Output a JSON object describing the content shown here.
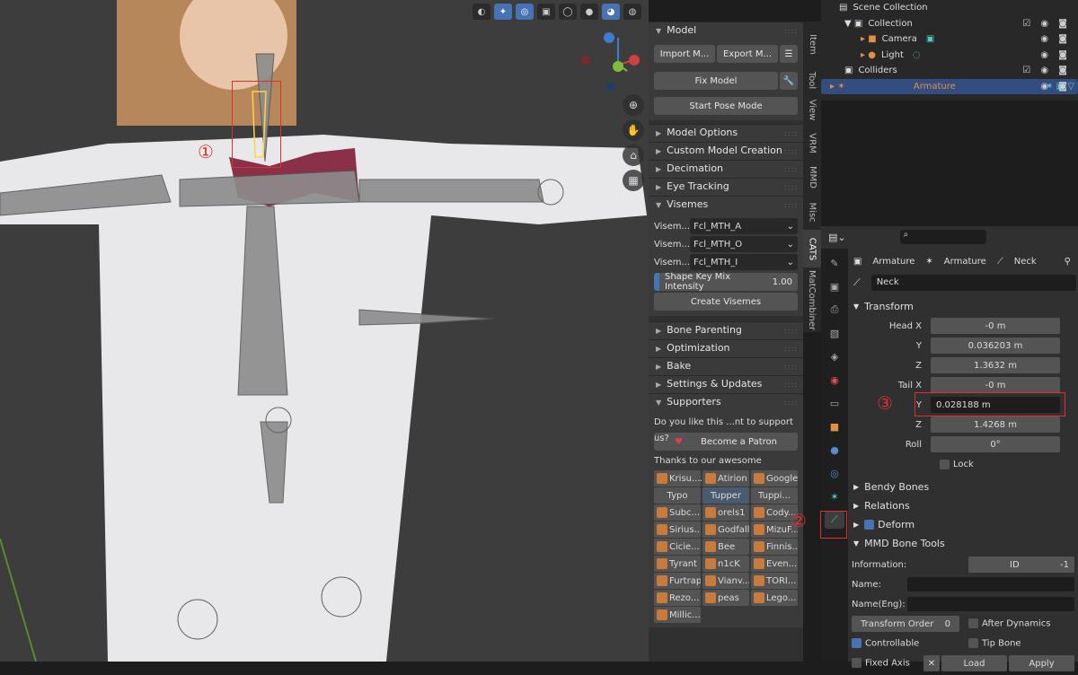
{
  "colors": {
    "accent": "#4772b3",
    "annotation": "#e0302d",
    "viewport": "#3d3d3d"
  },
  "npanel": {
    "model": {
      "title": "Model",
      "import": "Import M...",
      "export": "Export M...",
      "fix": "Fix Model",
      "pose": "Start Pose Mode"
    },
    "sections": [
      "Model Options",
      "Custom Model Creation",
      "Decimation",
      "Eye Tracking"
    ],
    "visemes": {
      "title": "Visemes",
      "rows": [
        {
          "label": "Visem...",
          "value": "Fcl_MTH_A"
        },
        {
          "label": "Visem...",
          "value": "Fcl_MTH_O"
        },
        {
          "label": "Visem...",
          "value": "Fcl_MTH_I"
        }
      ],
      "mix_label": "Shape Key Mix Intensity",
      "mix_value": "1.00",
      "create": "Create Visemes"
    },
    "sections2": [
      "Bone Parenting",
      "Optimization",
      "Bake",
      "Settings & Updates"
    ],
    "supporters": {
      "title": "Supporters",
      "question": "Do you like this ...nt to support us?",
      "patron": "Become a Patron",
      "thanks": "Thanks to our awesome supporte...",
      "rows": [
        [
          "Krisu...",
          "Atirion",
          "Google"
        ],
        [
          "Typo",
          "Tupper",
          "Tuppi..."
        ],
        [
          "Subc...",
          "orels1",
          "Cody..."
        ],
        [
          "Sirius...",
          "Godfall",
          "MizuF..."
        ],
        [
          "Cicie...",
          "Bee",
          "Finnis..."
        ],
        [
          "Tyrant",
          "n1cK",
          "Even..."
        ],
        [
          "Furtrap",
          "Vianv...",
          "TORI..."
        ],
        [
          "Rezo...",
          "peas",
          "Lego..."
        ],
        [
          "Millic...",
          "",
          ""
        ]
      ]
    }
  },
  "tabs": [
    "Item",
    "Tool",
    "View",
    "VRM",
    "MMD",
    "Misc",
    "CATS",
    "MatCombiner"
  ],
  "outliner": {
    "rows": [
      "Scene Collection",
      "Collection",
      "Camera",
      "Light",
      "Colliders",
      "Armature"
    ]
  },
  "props": {
    "search_placeholder": "",
    "breadcrumb": [
      "Armature",
      "Armature",
      "Neck"
    ],
    "bone_name": "Neck",
    "transform": {
      "title": "Transform",
      "head": [
        {
          "l": "Head X",
          "v": "-0 m"
        },
        {
          "l": "Y",
          "v": "0.036203 m"
        },
        {
          "l": "Z",
          "v": "1.3632 m"
        }
      ],
      "tail": [
        {
          "l": "Tail X",
          "v": "-0 m"
        },
        {
          "l": "Y",
          "v": "0.028188 m"
        },
        {
          "l": "Z",
          "v": "1.4268 m"
        }
      ],
      "roll_label": "Roll",
      "roll": "0°",
      "lock": "Lock"
    },
    "panels": [
      "Bendy Bones",
      "Relations",
      "Deform"
    ],
    "mmd": {
      "title": "MMD Bone Tools",
      "info_label": "Information:",
      "id_label": "ID",
      "id_value": "-1",
      "name": "Name:",
      "name_eng": "Name(Eng):",
      "order_label": "Transform Order",
      "order": "0",
      "after_dyn": "After Dynamics",
      "controllable": "Controllable",
      "tip": "Tip Bone",
      "fixed": "Fixed Axis",
      "load": "Load",
      "apply": "Apply"
    }
  },
  "annotations": [
    "①",
    "②",
    "③"
  ]
}
